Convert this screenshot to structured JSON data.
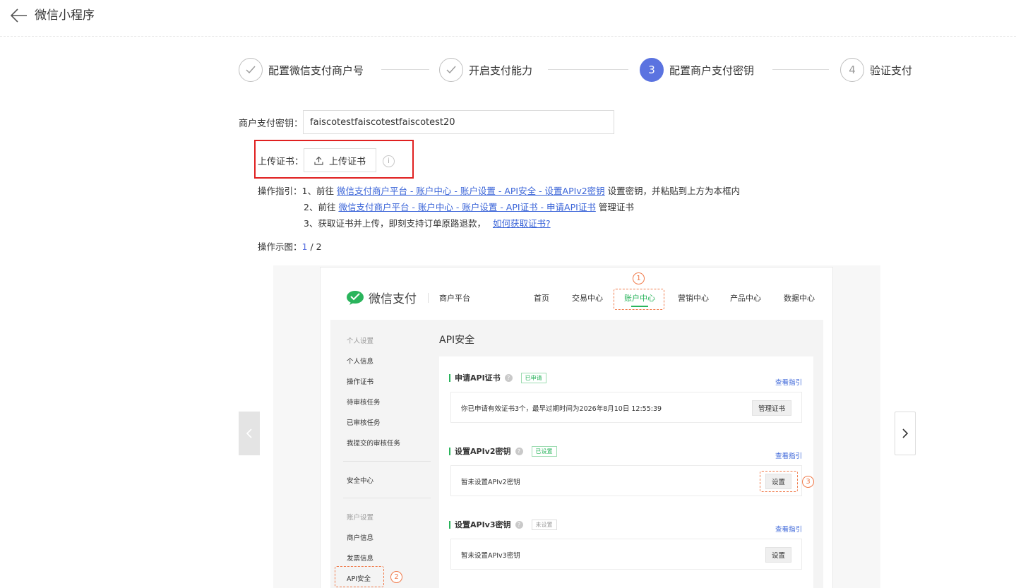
{
  "header": {
    "title": "微信小程序"
  },
  "steps": [
    {
      "marker": "",
      "label": "配置微信支付商户号",
      "status": "done"
    },
    {
      "marker": "",
      "label": "开启支付能力",
      "status": "done"
    },
    {
      "marker": "3",
      "label": "配置商户支付密钥",
      "status": "active"
    },
    {
      "marker": "4",
      "label": "验证支付",
      "status": "pending"
    }
  ],
  "form": {
    "key_label": "商户支付密钥：",
    "key_value": "faiscotestfaiscotestfaiscotest20",
    "cert_label": "上传证书：",
    "upload_button": "上传证书",
    "info_glyph": "i"
  },
  "guide": {
    "label": "操作指引：",
    "line1_prefix": "1、前往",
    "line1_link": "微信支付商户平台 - 账户中心 - 账户设置 - API安全 - 设置APIv2密钥",
    "line1_suffix": "设置密钥，并粘贴到上方为本框内",
    "line2_prefix": "2、前往",
    "line2_link": "微信支付商户平台 - 账户中心 - 账户设置 - API证书 - 申请API证书",
    "line2_suffix": "管理证书",
    "line3_text": "3、获取证书并上传，即刻支持订单原路退款，",
    "line3_link": "如何获取证书?"
  },
  "demo": {
    "label": "操作示图：",
    "current": "1",
    "separator": " / ",
    "total": "2"
  },
  "screenshot": {
    "logo_text": "微信支付",
    "platform": "商户平台",
    "nav": [
      "首页",
      "交易中心",
      "账户中心",
      "营销中心",
      "产品中心",
      "数据中心"
    ],
    "sidebar": {
      "group1": "个人设置",
      "items1": [
        "个人信息",
        "操作证书",
        "待审核任务",
        "已审核任务",
        "我提交的审核任务"
      ],
      "security": "安全中心",
      "group2": "账户设置",
      "items2": [
        "商户信息",
        "发票信息",
        "API安全"
      ]
    },
    "title": "API安全",
    "cards": [
      {
        "title": "申请API证书",
        "tag": "已申请",
        "guide": "查看指引",
        "text": "你已申请有效证书3个，最早过期时间为2026年8月10日 12:55:39",
        "button": "管理证书"
      },
      {
        "title": "设置APIv2密钥",
        "tag": "已设置",
        "guide": "查看指引",
        "text": "暂未设置APIv2密钥",
        "button": "设置"
      },
      {
        "title": "设置APIv3密钥",
        "tag": "未设置",
        "guide": "查看指引",
        "text": "暂未设置APIv3密钥",
        "button": "设置"
      }
    ],
    "markers": [
      "1",
      "2",
      "3"
    ],
    "q_glyph": "?"
  },
  "colors": {
    "accent": "#5b73e0",
    "highlight": "#e02020",
    "link": "#3a64d8",
    "wechat_green": "#2ab45c",
    "marker": "#f07a4a"
  }
}
